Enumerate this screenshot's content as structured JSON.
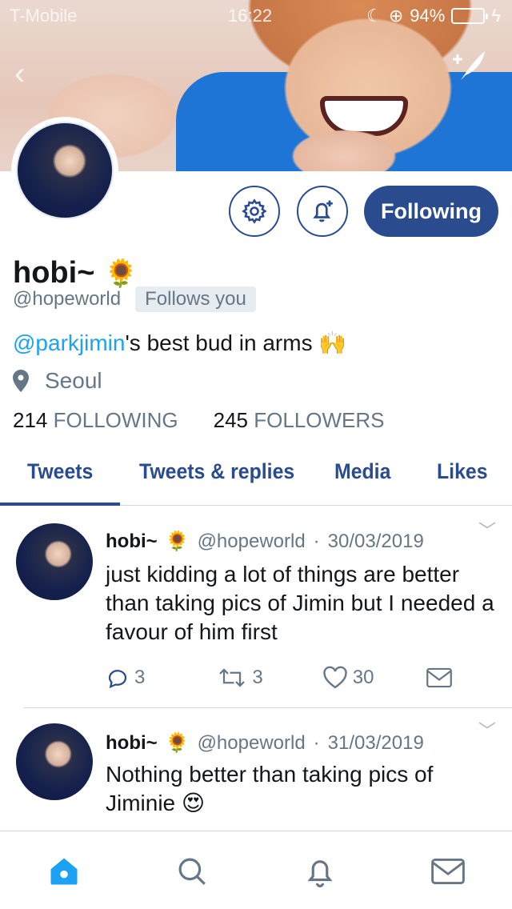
{
  "status_bar": {
    "carrier": "T-Mobile",
    "time": "16:22",
    "battery_percent": "94%",
    "battery_level": 0.94
  },
  "profile": {
    "name": "hobi~",
    "name_emoji": "🌻",
    "handle": "@hopeworld",
    "follows_you_badge": "Follows you",
    "bio_mention": "@parkjimin",
    "bio_rest": "'s best bud in arms 🙌",
    "location": "Seoul",
    "following_count": "214",
    "following_label": "FOLLOWING",
    "followers_count": "245",
    "followers_label": "FOLLOWERS",
    "follow_button_label": "Following"
  },
  "tabs": [
    {
      "label": "Tweets",
      "active": true
    },
    {
      "label": "Tweets & replies",
      "active": false
    },
    {
      "label": "Media",
      "active": false
    },
    {
      "label": "Likes",
      "active": false
    }
  ],
  "tweets": [
    {
      "name": "hobi~",
      "emoji": "🌻",
      "handle": "@hopeworld",
      "dot": "·",
      "date": "30/03/2019",
      "text": "just kidding a lot of things are better than taking pics of Jimin but I needed a favour of him first",
      "replies": "3",
      "retweets": "3",
      "likes": "30"
    },
    {
      "name": "hobi~",
      "emoji": "🌻",
      "handle": "@hopeworld",
      "dot": "·",
      "date": "31/03/2019",
      "text": "Nothing better than taking pics of Jiminie 😍"
    }
  ],
  "colors": {
    "accent": "#2a4b8d",
    "link": "#1da1f2",
    "secondary_text": "#657786",
    "divider": "#ccd6dd"
  },
  "icons": {
    "back": "chevron-left-icon",
    "compose": "compose-tweet-icon",
    "settings": "gear-icon",
    "notify": "bell-add-icon",
    "location": "location-pin-icon",
    "reply": "reply-icon",
    "retweet": "retweet-icon",
    "like": "heart-icon",
    "dm": "envelope-icon",
    "nav_home": "home-icon",
    "nav_search": "search-icon",
    "nav_notifications": "bell-icon",
    "nav_messages": "envelope-icon"
  }
}
